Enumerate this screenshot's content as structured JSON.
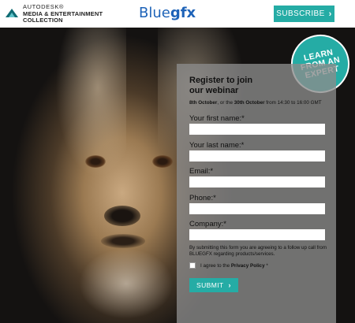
{
  "header": {
    "autodesk": {
      "line1": "AUTODESK®",
      "line2": "MEDIA & ENTERTAINMENT",
      "line3": "COLLECTION"
    },
    "brand": {
      "part1": "Blue",
      "part2": "gfx"
    },
    "subscribe_label": "SUBSCRIBE",
    "subscribe_icon": "chevron-right-icon"
  },
  "badge": {
    "text_line1": "LEARN",
    "text_line2": "FROM AN",
    "text_line3": "EXPERT"
  },
  "form": {
    "title_line1": "Register to join",
    "title_line2": "our webinar",
    "date_first": "8th October",
    "date_mid": ", or the ",
    "date_second": "30th October",
    "date_rest": " from 14:30 to 16:00 GMT",
    "fields": [
      {
        "label": "Your first name:*",
        "value": ""
      },
      {
        "label": "Your last name:*",
        "value": ""
      },
      {
        "label": "Email:*",
        "value": ""
      },
      {
        "label": "Phone:*",
        "value": ""
      },
      {
        "label": "Company:*",
        "value": ""
      }
    ],
    "consent_text": "By submitting this form you are agreeing to a follow up call from BLUEGFX regarding products/services.",
    "agree_prefix": "I agree to the ",
    "agree_link": "Privacy Policy",
    "agree_suffix": " *",
    "submit_label": "SUBMIT"
  },
  "colors": {
    "accent": "#25aca5",
    "brand_blue": "#1e63b8",
    "panel_bg": "#8c8c8c"
  }
}
